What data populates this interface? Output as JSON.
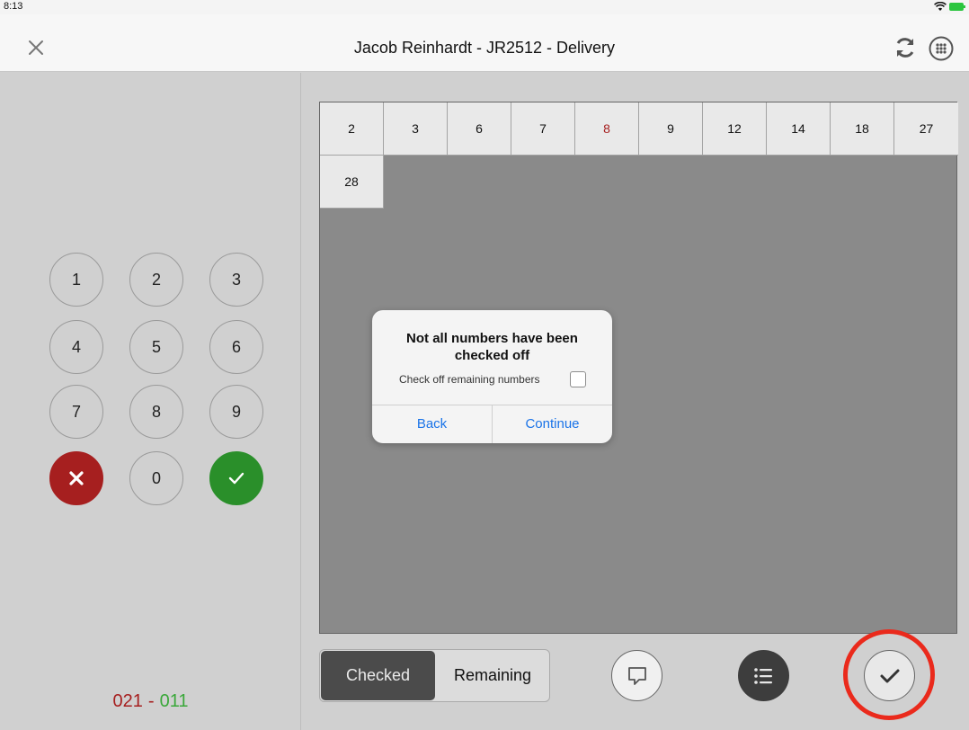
{
  "status_bar": {
    "time": "8:13"
  },
  "nav": {
    "title": "Jacob Reinhardt - JR2512 - Delivery"
  },
  "keypad": {
    "keys": [
      "1",
      "2",
      "3",
      "4",
      "5",
      "6",
      "7",
      "8",
      "9"
    ],
    "zero": "0"
  },
  "counter": {
    "left": "021",
    "separator": "-",
    "right": "011"
  },
  "grid": {
    "numbers": [
      "2",
      "3",
      "6",
      "7",
      "8",
      "9",
      "12",
      "14",
      "18",
      "27",
      "28"
    ],
    "highlighted": "8"
  },
  "alert": {
    "title": "Not all numbers have been checked off",
    "checkbox_label": "Check off remaining numbers",
    "back_label": "Back",
    "continue_label": "Continue"
  },
  "toolbar": {
    "checked_label": "Checked",
    "remaining_label": "Remaining"
  },
  "colors": {
    "red": "#a61f1f",
    "green": "#2a8f2a",
    "link_blue": "#1a73e8",
    "highlight_ring": "#ea2a1c"
  }
}
